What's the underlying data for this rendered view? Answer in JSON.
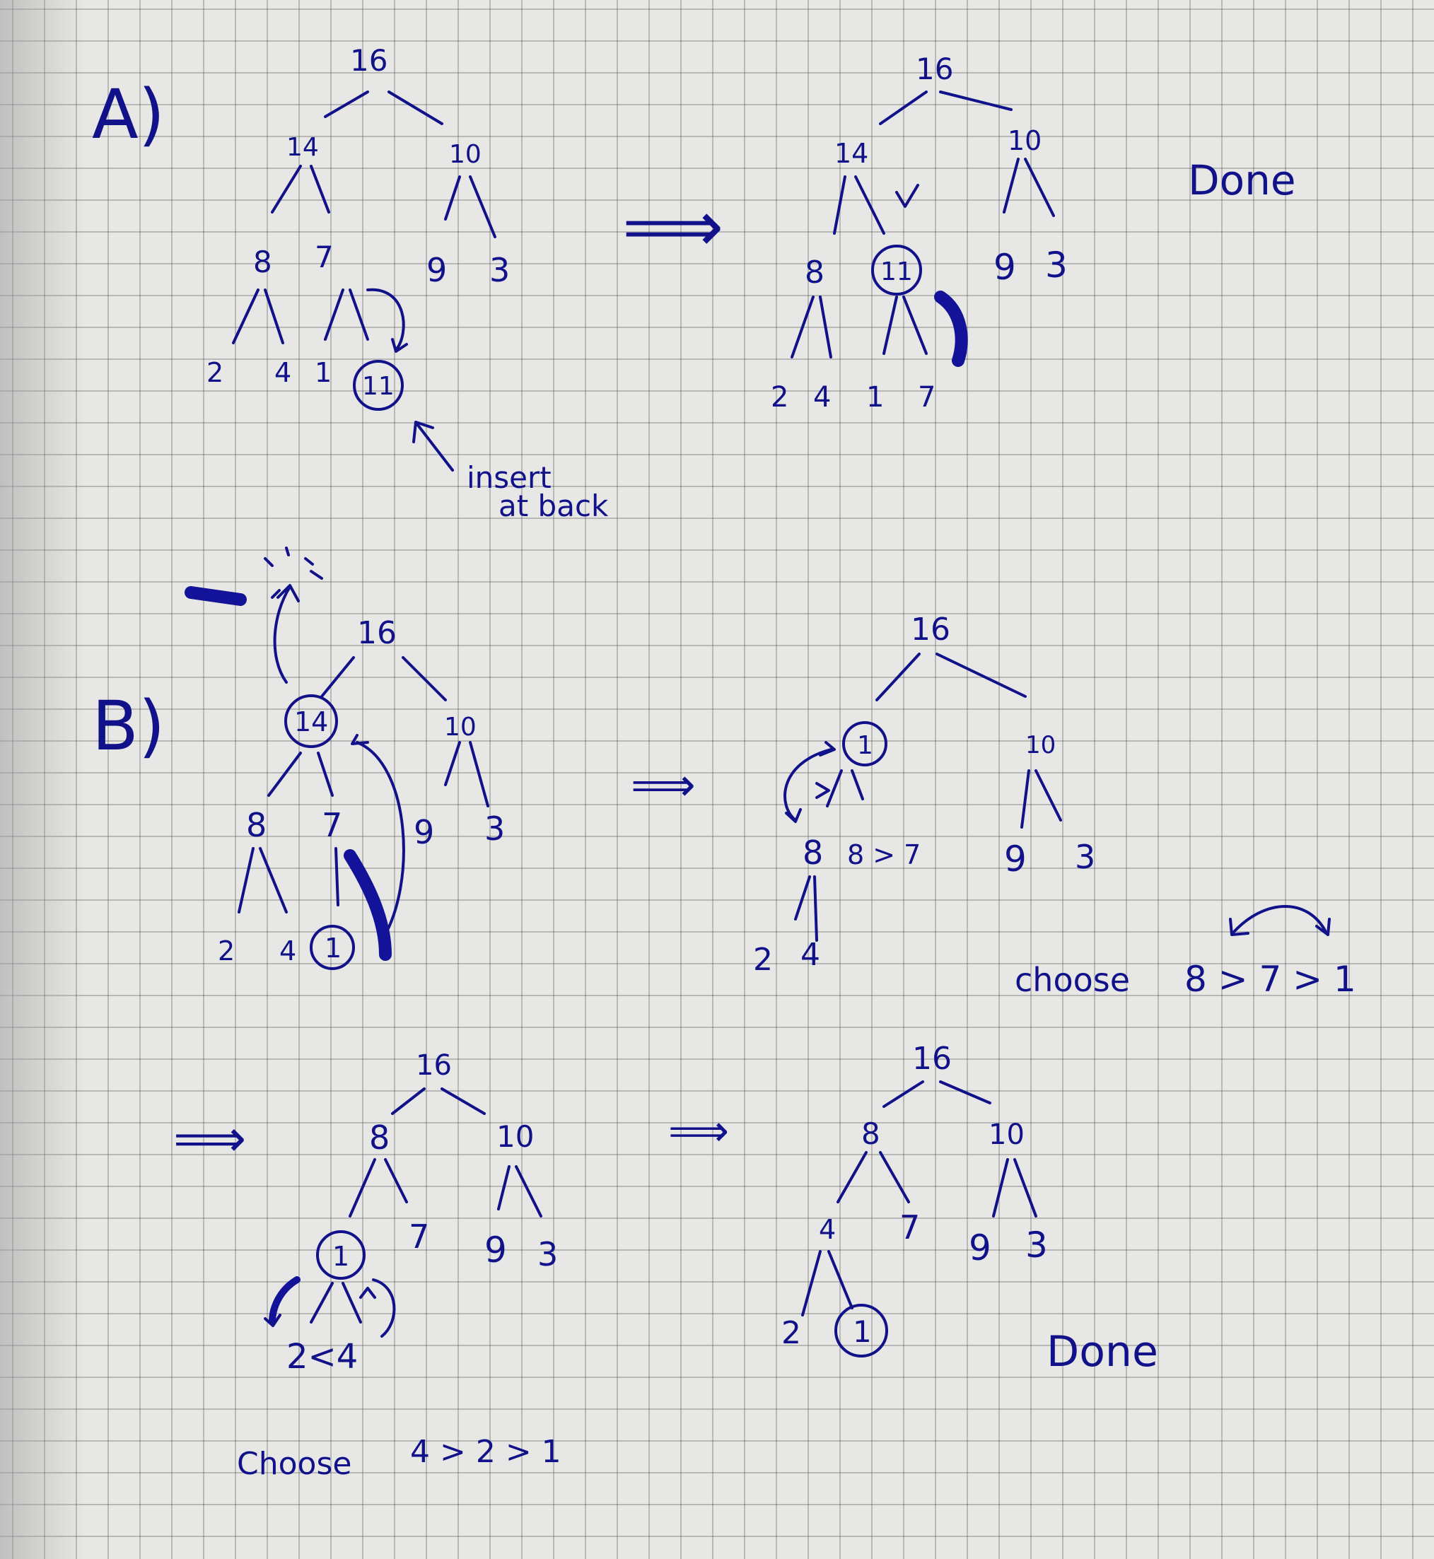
{
  "labels": {
    "part_a": "A)",
    "part_b": "B)",
    "insert_line1": "insert",
    "insert_line2": "at back",
    "done_a": "Done",
    "done_b": "Done",
    "choose_1": "choose",
    "choose_1_order": "8 > 7 > 1",
    "choose_2": "Choose",
    "choose_2_order": "4 > 2 > 1",
    "compare_8_7": "8 > 7",
    "compare_2_4": "2<4",
    "checkmark": "✓"
  },
  "arrows": {
    "step": "⟹"
  },
  "trees": {
    "a_before": {
      "nodes": [
        "16",
        "14",
        "10",
        "8",
        "7",
        "9",
        "3",
        "2",
        "4",
        "1",
        "11"
      ],
      "circled": "11"
    },
    "a_after": {
      "nodes": [
        "16",
        "14",
        "10",
        "8",
        "11",
        "9",
        "3",
        "2",
        "4",
        "1",
        "7"
      ],
      "circled": "11"
    },
    "b_remove": {
      "nodes": [
        "16",
        "14",
        "10",
        "8",
        "7",
        "9",
        "3",
        "2",
        "4",
        "1"
      ],
      "circled": [
        "14",
        "1"
      ]
    },
    "b_step1": {
      "nodes": [
        "16",
        "1",
        "10",
        "8",
        "7",
        "9",
        "3",
        "2",
        "4"
      ],
      "circled": "1"
    },
    "b_step2": {
      "nodes": [
        "16",
        "8",
        "10",
        "1",
        "7",
        "9",
        "3"
      ],
      "circled": "1"
    },
    "b_final": {
      "nodes": [
        "16",
        "8",
        "10",
        "4",
        "7",
        "9",
        "3",
        "2",
        "1"
      ],
      "circled": "1"
    }
  },
  "colors": {
    "ink": "#11118a",
    "paper": "#e7e7e5",
    "grid": "#7a7a7a"
  }
}
